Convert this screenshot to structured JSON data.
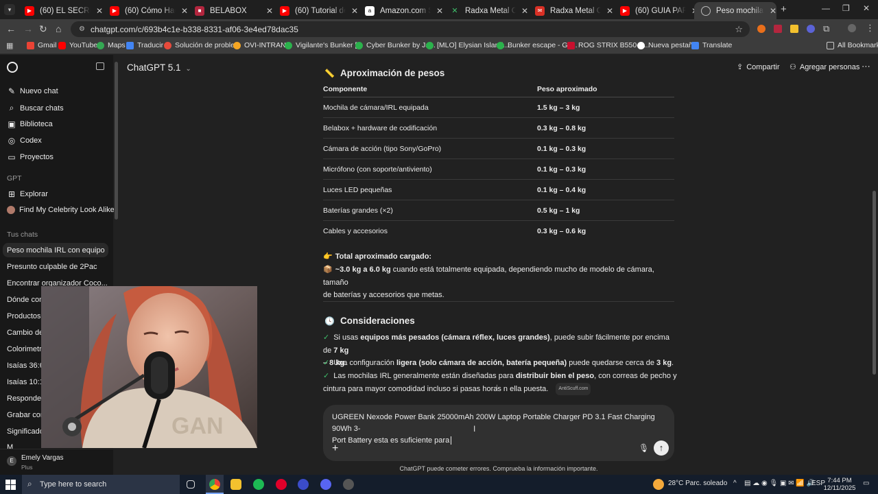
{
  "browser": {
    "tabs": [
      {
        "title": "(60) EL SECRETO de lo",
        "favicon": "youtube-icon"
      },
      {
        "title": "(60) Cómo Hacer Stre",
        "favicon": "youtube-icon"
      },
      {
        "title": "BELABOX",
        "favicon": "belabox-icon"
      },
      {
        "title": "(60) Tutorial del siste",
        "favicon": "youtube-icon"
      },
      {
        "title": "Amazon.com Shoppi",
        "favicon": "amazon-icon"
      },
      {
        "title": "Radxa Metal Case for",
        "favicon": "radxa-icon"
      },
      {
        "title": "Radxa Metal Case for",
        "favicon": "gmail-icon"
      },
      {
        "title": "(60) GUIA PARA EL ST",
        "favicon": "youtube-icon"
      },
      {
        "title": "Peso mochila IRL con",
        "favicon": "chatgpt-icon"
      }
    ],
    "url": "chatgpt.com/c/693b4c1e-b338-8331-af06-3e4ed78dac35",
    "bookmarks": [
      {
        "label": "Gmail",
        "color": "#ea4335"
      },
      {
        "label": "YouTube",
        "color": "#ff0000"
      },
      {
        "label": "Maps",
        "color": "#34a853"
      },
      {
        "label": "Traducir",
        "color": "#4285f4"
      },
      {
        "label": "Solución de proble...",
        "color": "#e84a3b"
      },
      {
        "label": "OVI-INTRANT",
        "color": "#f5a623"
      },
      {
        "label": "Vigilante's Bunker [...",
        "color": "#2bb24c"
      },
      {
        "label": "Cyber Bunker by Ja...",
        "color": "#2bb24c"
      },
      {
        "label": "[MLO] Elysian Island...",
        "color": "#2bb24c"
      },
      {
        "label": "Bunker escape - GT...",
        "color": "#2bb24c"
      },
      {
        "label": "ROG STRIX B550-A...",
        "color": "#c8102e"
      },
      {
        "label": "Nueva pestaña",
        "color": "#ffffff"
      },
      {
        "label": "Translate",
        "color": "#4285f4"
      }
    ],
    "all_bookmarks": "All Bookmarks"
  },
  "sidebar": {
    "actions": [
      {
        "label": "Nuevo chat",
        "icon": "edit-icon"
      },
      {
        "label": "Buscar chats",
        "icon": "search-icon"
      },
      {
        "label": "Biblioteca",
        "icon": "library-icon"
      },
      {
        "label": "Codex",
        "icon": "codex-icon"
      },
      {
        "label": "Proyectos",
        "icon": "folder-icon"
      }
    ],
    "gpt_section": "GPT",
    "gpts": [
      {
        "label": "Explorar",
        "icon": "grid-icon"
      },
      {
        "label": "Find My Celebrity Look Alike",
        "icon": "avatar-icon"
      }
    ],
    "chats_section": "Tus chats",
    "chats": [
      "Peso mochila IRL con equipo",
      "Presunto culpable de 2Pac",
      "Encontrar organizador Coco...",
      "Dónde comp",
      "Productos s",
      "Cambio de L",
      "Colorimetría",
      "Isaías 36:6-7",
      "Isaías 10:16-",
      "Responder n",
      "Grabar con A",
      "Significado l",
      "M"
    ],
    "user": {
      "name": "Emely Vargas",
      "plan": "Plus",
      "initial": "E"
    }
  },
  "header": {
    "model": "ChatGPT 5.1",
    "share": "Compartir",
    "add_people": "Agregar personas"
  },
  "message": {
    "section_weights": "Aproximación de pesos",
    "table_headers": [
      "Componente",
      "Peso aproximado"
    ],
    "table_rows": [
      [
        "Mochila de cámara/IRL equipada",
        "1.5 kg – 3 kg"
      ],
      [
        "Belabox + hardware de codificación",
        "0.3 kg – 0.8 kg"
      ],
      [
        "Cámara de acción (tipo Sony/GoPro)",
        "0.1 kg – 0.3 kg"
      ],
      [
        "Micrófono (con soporte/antiviento)",
        "0.1 kg – 0.3 kg"
      ],
      [
        "Luces LED pequeñas",
        "0.1 kg – 0.4 kg"
      ],
      [
        "Baterías grandes (×2)",
        "0.5 kg – 1 kg"
      ],
      [
        "Cables y accesorios",
        "0.3 kg – 0.6 kg"
      ]
    ],
    "total_title": "Total aproximado cargado:",
    "total_bold": "~3.0 kg a 6.0 kg",
    "total_rest1": " cuando está totalmente equipada, dependiendo mucho de modelo de cámara, tamaño",
    "total_rest2": "de baterías y accesorios que metas.",
    "section_considerations": "Consideraciones",
    "c1_a": "Si usas ",
    "c1_b": "equipos más pesados (cámara réflex, luces grandes)",
    "c1_c": ", puede subir fácilmente por encima de ",
    "c1_d": "7 kg",
    "c1_e": "– 8 kg",
    "c1_f": ".",
    "c2_a": "Una configuración ",
    "c2_b": "ligera (solo cámara de acción, batería pequeña)",
    "c2_c": " puede quedarse cerca de ",
    "c2_d": "3 kg",
    "c2_e": ".",
    "c3_a": "Las mochilas IRL generalmente están diseñadas para ",
    "c3_b": "distribuir bien el peso",
    "c3_c": ", con correas de pecho y",
    "c3_d": "cintura para mayor comodidad incluso si pasas horas ",
    "c3_e": "n ella puesta.",
    "watermark": "AntiScuff.com"
  },
  "composer": {
    "text_line1": "UGREEN Nexode Power Bank 25000mAh 200W Laptop Portable Charger PD 3.1 Fast Charging 90Wh 3-",
    "text_line2": "Port Battery esta es suficiente para"
  },
  "footer_note": "ChatGPT puede cometer errores. Comprueba la información importante.",
  "taskbar": {
    "search_placeholder": "Type here to search",
    "weather": "28°C  Parc. soleado",
    "lang": "ESP",
    "time": "7:44 PM",
    "date": "12/11/2025"
  }
}
